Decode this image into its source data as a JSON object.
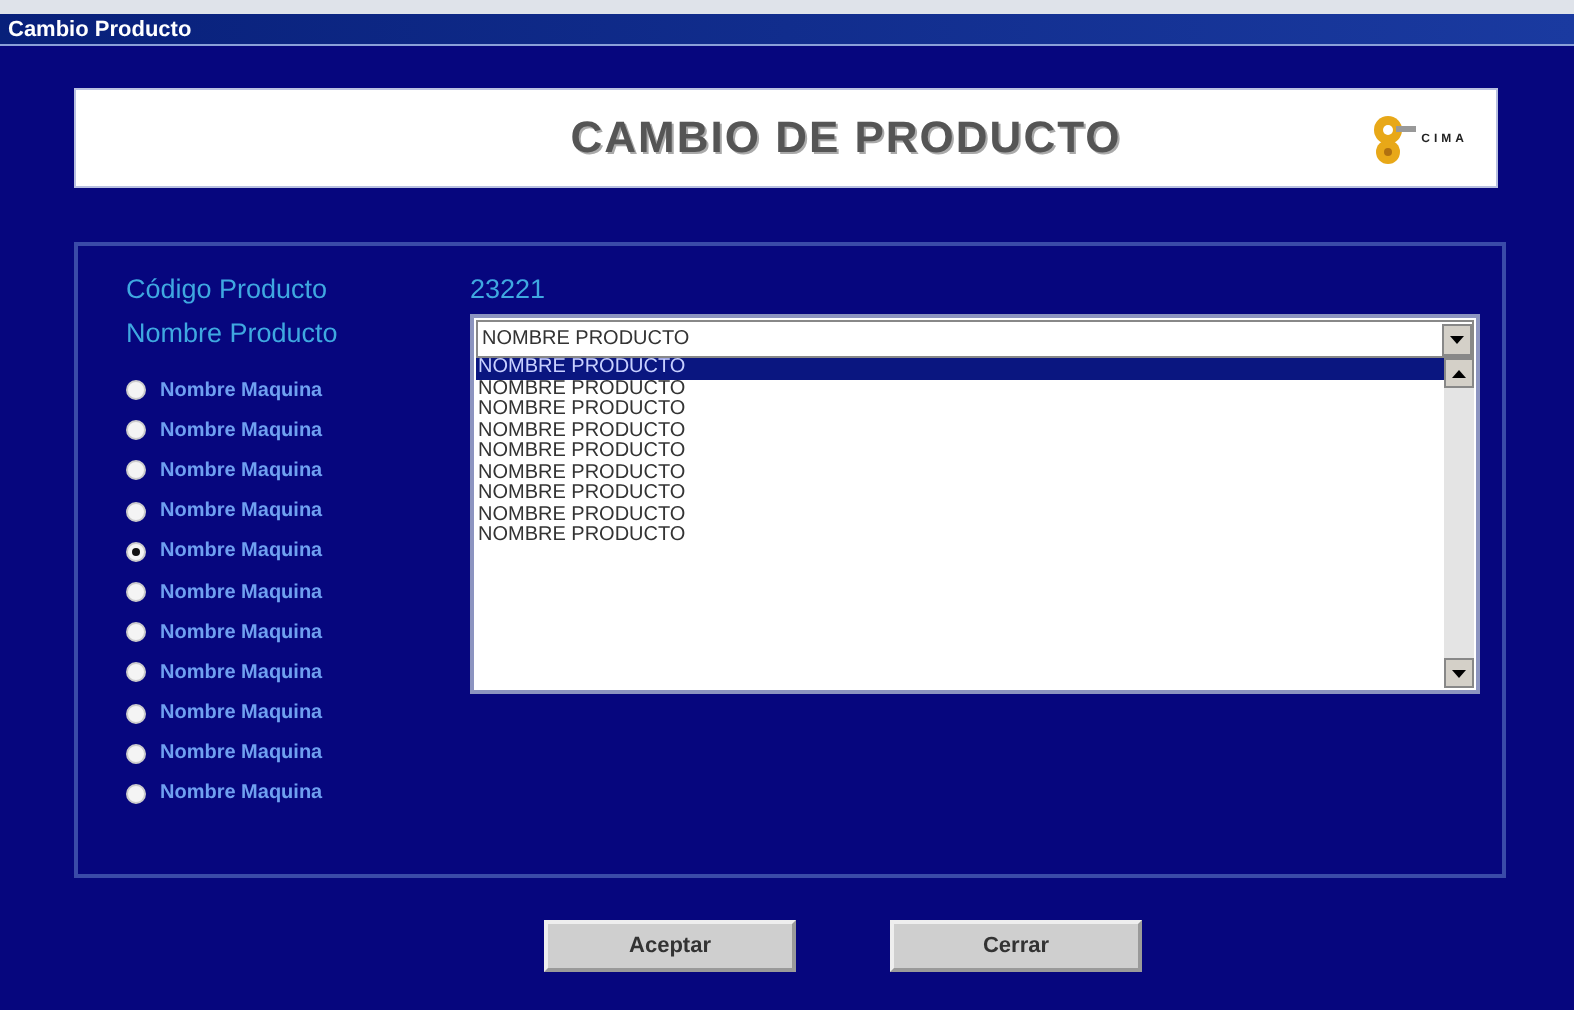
{
  "window": {
    "title": "Cambio Producto"
  },
  "header": {
    "title": "CAMBIO DE PRODUCTO",
    "logo_text": "CIMA"
  },
  "fields": [
    {
      "label": "Código Producto",
      "value": "23221"
    },
    {
      "label": "Nombre Producto",
      "value": "NOMBRE PRODUCTO"
    }
  ],
  "machines": [
    {
      "label": "Nombre Maquina",
      "selected": false
    },
    {
      "label": "Nombre Maquina",
      "selected": false
    },
    {
      "label": "Nombre Maquina",
      "selected": false
    },
    {
      "label": "Nombre Maquina",
      "selected": false
    },
    {
      "label": "Nombre Maquina",
      "selected": true
    },
    {
      "label": "Nombre Maquina",
      "selected": false
    },
    {
      "label": "Nombre Maquina",
      "selected": false
    },
    {
      "label": "Nombre Maquina",
      "selected": false
    },
    {
      "label": "Nombre Maquina",
      "selected": false
    },
    {
      "label": "Nombre Maquina",
      "selected": false
    },
    {
      "label": "Nombre Maquina",
      "selected": false
    }
  ],
  "product_list": [
    {
      "label": "NOMBRE PRODUCTO",
      "selected": true
    },
    {
      "label": "NOMBRE PRODUCTO",
      "selected": false
    },
    {
      "label": "NOMBRE PRODUCTO",
      "selected": false
    },
    {
      "label": "NOMBRE PRODUCTO",
      "selected": false
    },
    {
      "label": "NOMBRE PRODUCTO",
      "selected": false
    },
    {
      "label": "NOMBRE PRODUCTO",
      "selected": false
    },
    {
      "label": "NOMBRE PRODUCTO",
      "selected": false
    },
    {
      "label": "NOMBRE PRODUCTO",
      "selected": false
    },
    {
      "label": "NOMBRE PRODUCTO",
      "selected": false
    }
  ],
  "buttons": [
    "Aceptar",
    "Cerrar"
  ]
}
